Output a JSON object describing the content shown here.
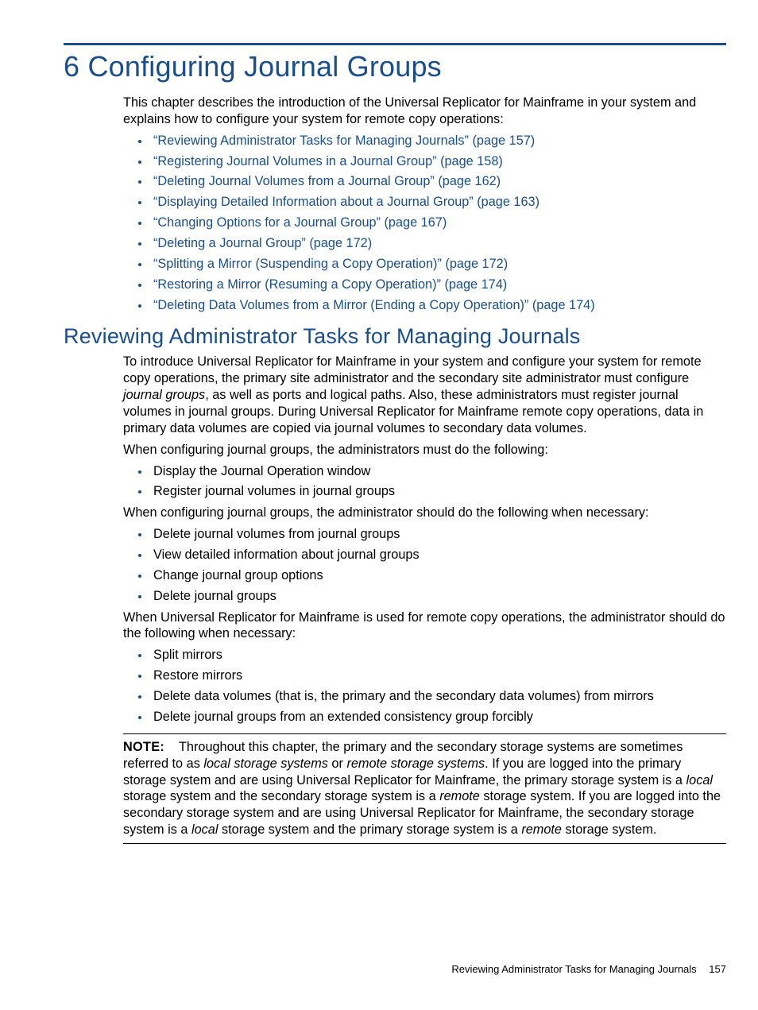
{
  "chapter": {
    "number": "6",
    "title": "Configuring Journal Groups",
    "intro": "This chapter describes the introduction of the Universal Replicator for Mainframe in your system and explains how to configure your system for remote copy operations:",
    "links": [
      "“Reviewing Administrator Tasks for Managing Journals” (page 157)",
      "“Registering Journal Volumes in a Journal Group” (page 158)",
      "“Deleting Journal Volumes from a Journal Group” (page 162)",
      "“Displaying Detailed Information about a Journal Group” (page 163)",
      "“Changing Options for a Journal Group” (page 167)",
      "“Deleting a Journal Group” (page 172)",
      "“Splitting a Mirror (Suspending a Copy Operation)” (page 172)",
      "“Restoring a Mirror (Resuming a Copy Operation)” (page 174)",
      "“Deleting Data Volumes from a Mirror (Ending a Copy Operation)” (page 174)"
    ]
  },
  "section": {
    "title": "Reviewing Administrator Tasks for Managing Journals",
    "para1_pre": "To introduce Universal Replicator for Mainframe in your system and configure your system for remote copy operations, the primary site administrator and the secondary site administrator must configure ",
    "para1_em": "journal groups",
    "para1_post": ", as well as ports and logical paths. Also, these administrators must register journal volumes in journal groups. During Universal Replicator for Mainframe remote copy operations, data in primary data volumes are copied via journal volumes to secondary data volumes.",
    "para2": "When configuring journal groups, the administrators must do the following:",
    "must_list": [
      "Display the Journal Operation window",
      "Register journal volumes in journal groups"
    ],
    "para3": "When configuring journal groups, the administrator should do the following when necessary:",
    "should_list": [
      "Delete journal volumes from journal groups",
      "View detailed information about journal groups",
      "Change journal group options",
      "Delete journal groups"
    ],
    "para4": "When Universal Replicator for Mainframe is used for remote copy operations, the administrator should do the following when necessary:",
    "ops_list": [
      "Split mirrors",
      "Restore mirrors",
      "Delete data volumes (that is, the primary and the secondary data volumes) from mirrors",
      "Delete journal groups from an extended consistency group forcibly"
    ]
  },
  "note": {
    "label": "NOTE:",
    "t0": "Throughout this chapter, the primary and the secondary storage systems are sometimes referred to as ",
    "e1": "local storage systems",
    "t1": " or ",
    "e2": "remote storage systems",
    "t2": ". If you are logged into the primary storage system and are using Universal Replicator for Mainframe, the primary storage system is a ",
    "e3": "local",
    "t3": " storage system and the secondary storage system is a ",
    "e4": "remote",
    "t4": " storage system. If you are logged into the secondary storage system and are using Universal Replicator for Mainframe, the secondary storage system is a ",
    "e5": "local",
    "t5": " storage system and the primary storage system is a ",
    "e6": "remote",
    "t6": " storage system."
  },
  "footer": {
    "title": "Reviewing Administrator Tasks for Managing Journals",
    "page": "157"
  }
}
